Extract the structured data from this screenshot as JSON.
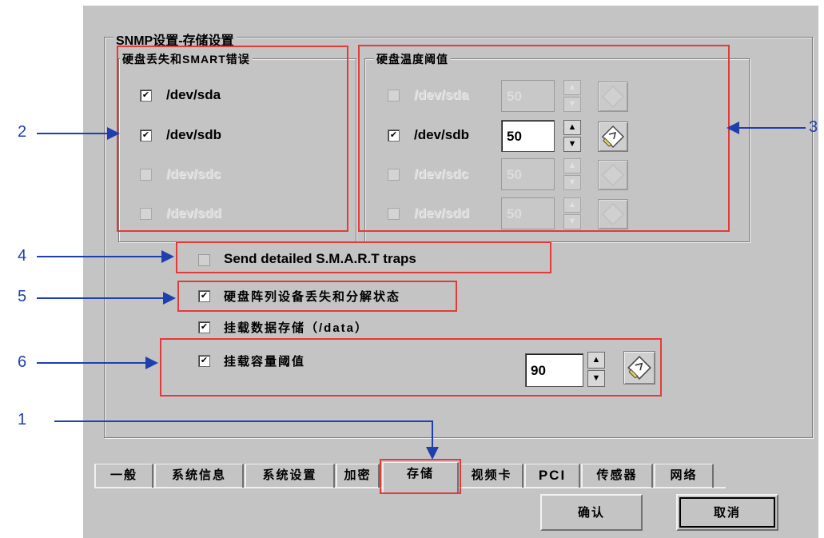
{
  "section_title": "SNMP设置-存储设置",
  "loss_group": {
    "title": "硬盘丢失和SMART错误",
    "items": [
      {
        "label": "/dev/sda",
        "checked": true,
        "enabled": true
      },
      {
        "label": "/dev/sdb",
        "checked": true,
        "enabled": true
      },
      {
        "label": "/dev/sdc",
        "checked": false,
        "enabled": false
      },
      {
        "label": "/dev/sdd",
        "checked": false,
        "enabled": false
      }
    ]
  },
  "temp_group": {
    "title": "硬盘温度阈值",
    "items": [
      {
        "label": "/dev/sda",
        "value": "50",
        "checked": false,
        "enabled": false
      },
      {
        "label": "/dev/sdb",
        "value": "50",
        "checked": true,
        "enabled": true
      },
      {
        "label": "/dev/sdc",
        "value": "50",
        "checked": false,
        "enabled": false
      },
      {
        "label": "/dev/sdd",
        "value": "50",
        "checked": false,
        "enabled": false
      }
    ]
  },
  "options": {
    "smart_traps": {
      "label": "Send detailed S.M.A.R.T traps",
      "checked": false
    },
    "raid_status": {
      "label": "硬盘阵列设备丢失和分解状态",
      "checked": true
    },
    "mount_data": {
      "label": "挂载数据存储（/data）",
      "checked": true
    },
    "mount_threshold": {
      "label": "挂载容量阈值",
      "checked": true,
      "value": "90"
    }
  },
  "tabs": [
    "一般",
    "系统信息",
    "系统设置",
    "加密",
    "存储",
    "视频卡",
    "PCI",
    "传感器",
    "网络"
  ],
  "active_tab": "存储",
  "buttons": {
    "ok": "确认",
    "cancel": "取消"
  },
  "callouts": [
    "1",
    "2",
    "3",
    "4",
    "5",
    "6"
  ],
  "colors": {
    "panel": "#c4c4c4",
    "highlight_box": "#e43a3a",
    "callout_arrow": "#1f3fae"
  },
  "icons": [
    "checkbox-check-icon",
    "spin-up-icon",
    "spin-down-icon",
    "apply-pencil-icon",
    "arrow-icon"
  ]
}
